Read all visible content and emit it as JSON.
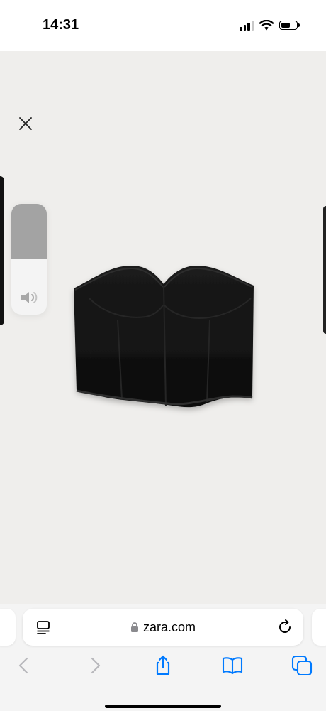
{
  "status_bar": {
    "time": "14:31",
    "battery_level": 0.65,
    "signal_bars": 3,
    "icons": [
      "signal-icon",
      "wifi-icon",
      "battery-icon"
    ]
  },
  "viewer": {
    "background": "#efeeec",
    "close_icon": "close-icon",
    "product_image": "black-corset-top-photo"
  },
  "volume_hud": {
    "level": 0.5,
    "icon": "speaker-icon"
  },
  "safari": {
    "url": "zara.com",
    "secure": true,
    "icons": {
      "reader": "page-menu-icon",
      "lock": "lock-icon",
      "reload": "reload-icon",
      "back": "back-chevron-icon",
      "forward": "forward-chevron-icon",
      "share": "share-icon",
      "bookmarks": "bookmarks-icon",
      "tabs": "tabs-icon"
    },
    "accent": "#007aff",
    "disabled": "#b8b8bc"
  }
}
